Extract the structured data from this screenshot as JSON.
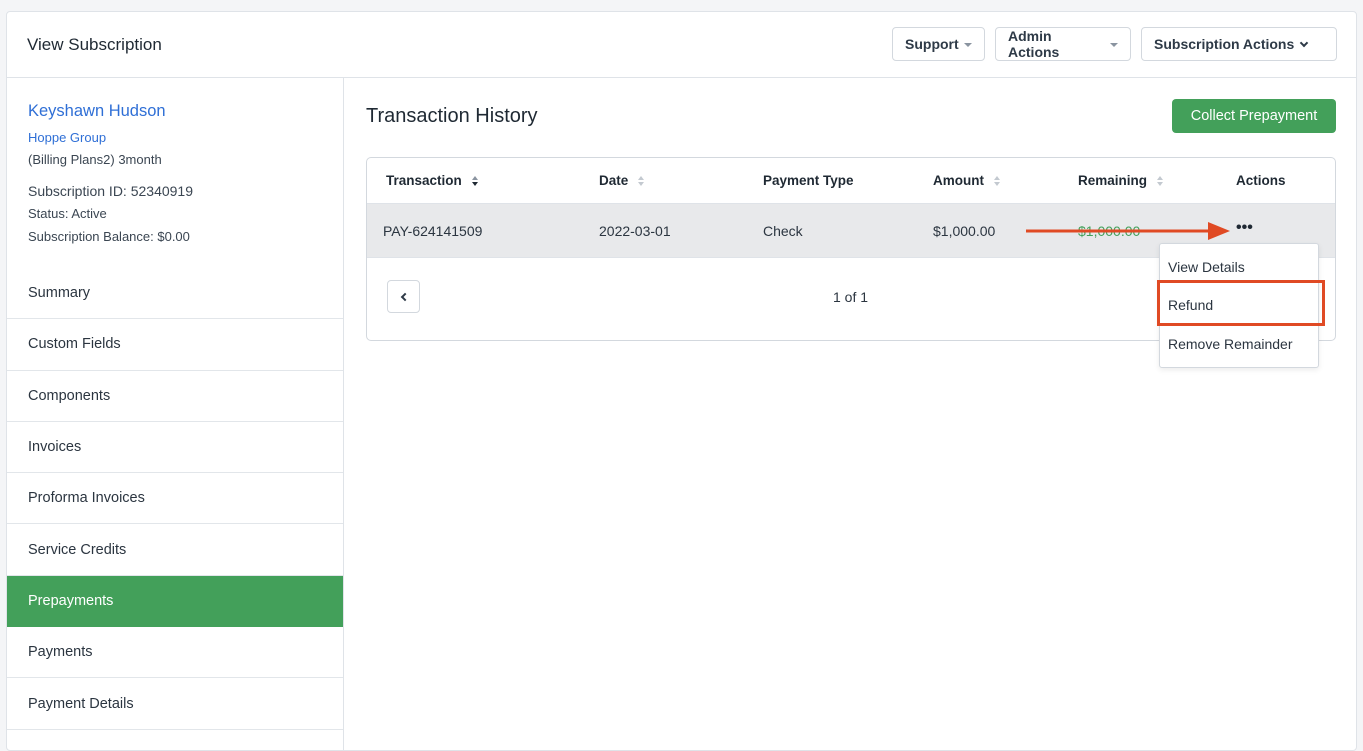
{
  "header": {
    "title": "View Subscription",
    "buttons": {
      "support": "Support",
      "admin_actions": "Admin Actions",
      "subscription_actions": "Subscription Actions"
    }
  },
  "customer": {
    "name": "Keyshawn Hudson",
    "organization": "Hoppe Group",
    "plan": "(Billing Plans2) 3month",
    "subscription_id": "Subscription ID: 52340919",
    "status": "Status: Active",
    "balance": "Subscription Balance: $0.00"
  },
  "sidebar": {
    "items": [
      {
        "label": "Summary"
      },
      {
        "label": "Custom Fields"
      },
      {
        "label": "Components"
      },
      {
        "label": "Invoices"
      },
      {
        "label": "Proforma Invoices"
      },
      {
        "label": "Service Credits"
      },
      {
        "label": "Prepayments"
      },
      {
        "label": "Payments"
      },
      {
        "label": "Payment Details"
      }
    ],
    "active": "Prepayments"
  },
  "main": {
    "title": "Transaction History",
    "collect_button": "Collect Prepayment",
    "table": {
      "columns": {
        "transaction": "Transaction",
        "date": "Date",
        "payment_type": "Payment Type",
        "amount": "Amount",
        "remaining": "Remaining",
        "actions": "Actions"
      },
      "rows": [
        {
          "transaction": "PAY-624141509",
          "date": "2022-03-01",
          "payment_type": "Check",
          "amount": "$1,000.00",
          "remaining": "$1,000.00",
          "actions_icon": "•••"
        }
      ]
    },
    "pagination": {
      "text": "1 of 1"
    }
  },
  "actions_menu": {
    "items": {
      "view_details": "View Details",
      "refund": "Refund",
      "remove_remainder": "Remove Remainder"
    },
    "highlighted": "Refund"
  },
  "colors": {
    "accent_green": "#43a05a",
    "link_blue": "#2f6fd6",
    "annotation_red": "#e04a24"
  }
}
